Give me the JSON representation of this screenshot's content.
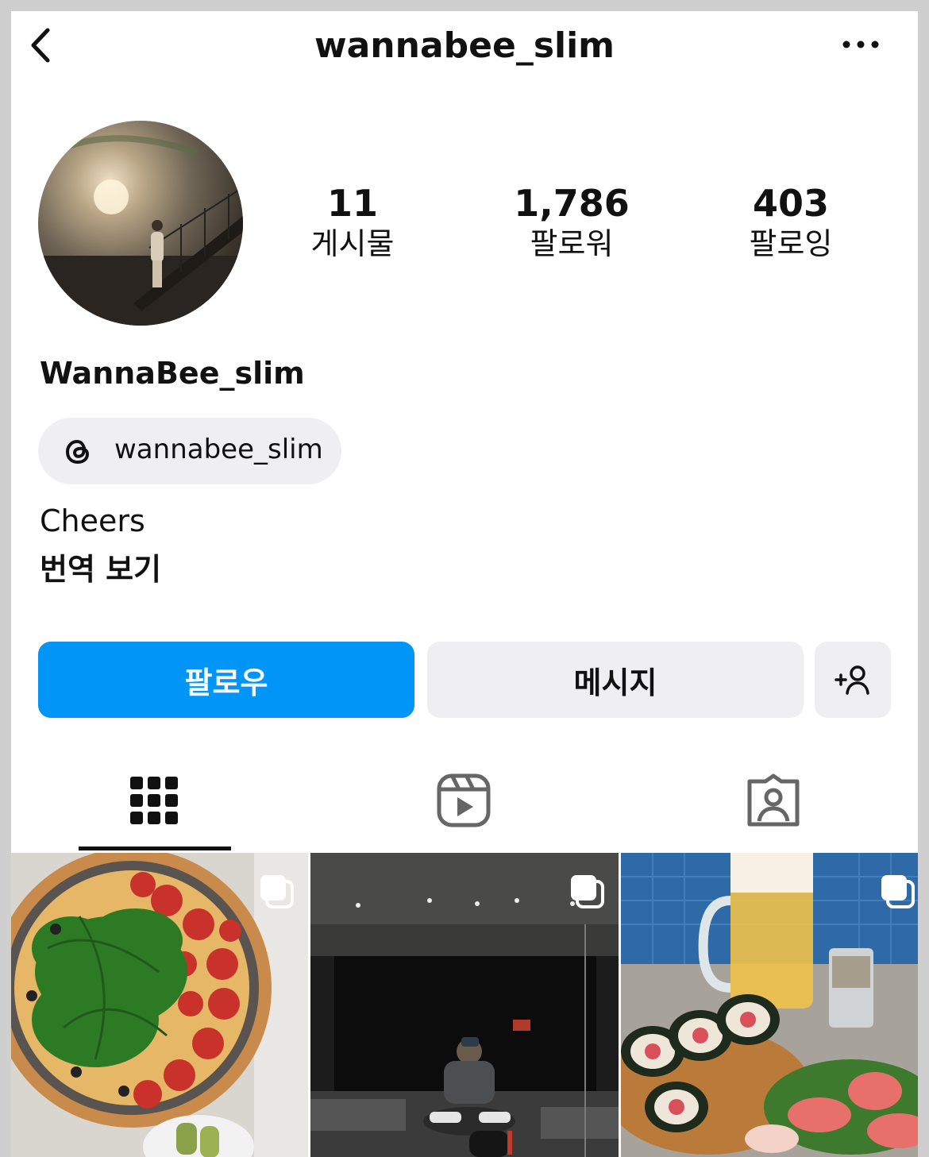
{
  "header": {
    "username": "wannabee_slim"
  },
  "profile": {
    "stats": [
      {
        "value": "11",
        "label": "게시물"
      },
      {
        "value": "1,786",
        "label": "팔로워"
      },
      {
        "value": "403",
        "label": "팔로잉"
      }
    ],
    "display_name": "WannaBee_slim",
    "threads_handle": "wannabee_slim",
    "bio": "Cheers",
    "translate_label": "번역 보기"
  },
  "actions": {
    "follow_label": "팔로우",
    "message_label": "메시지"
  },
  "tabs": [
    {
      "name": "grid-icon",
      "active": true
    },
    {
      "name": "reels-icon",
      "active": false
    },
    {
      "name": "tagged-icon",
      "active": false
    }
  ],
  "posts": [
    {
      "subject": "pizza-photo",
      "carousel": true
    },
    {
      "subject": "gym-mirror-selfie-photo",
      "carousel": true
    },
    {
      "subject": "beer-and-sushi-photo",
      "carousel": true
    }
  ],
  "colors": {
    "accent": "#0095f6",
    "button_secondary": "#efeff1"
  }
}
